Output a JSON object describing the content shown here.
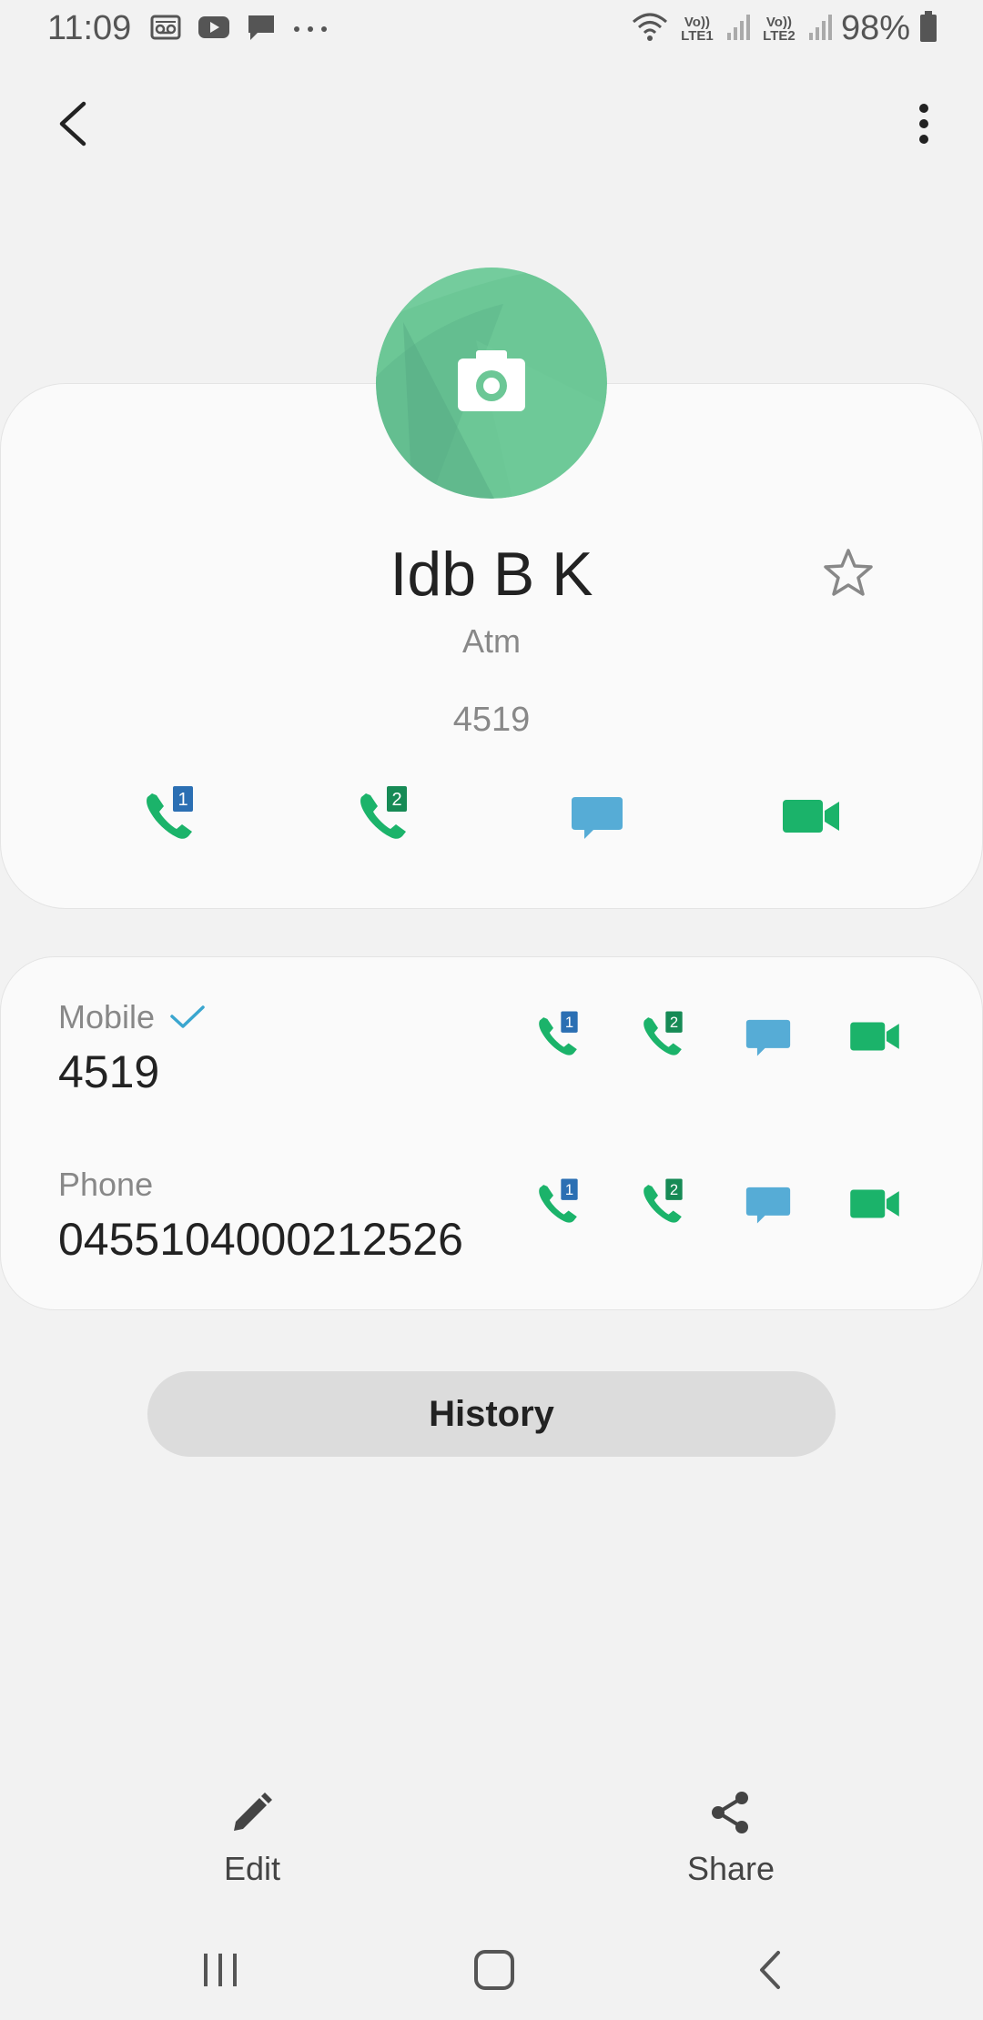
{
  "status_bar": {
    "time": "11:09",
    "sim1_label": "Vo)) LTE1",
    "sim2_label": "Vo)) LTE2",
    "battery": "98%"
  },
  "contact": {
    "name": "Idb B K",
    "company": "Atm",
    "number": "4519"
  },
  "numbers": [
    {
      "label": "Mobile",
      "value": "4519",
      "default": true
    },
    {
      "label": "Phone",
      "value": "04551040002125 26"
    }
  ],
  "history_label": "History",
  "bottom_actions": {
    "edit_label": "Edit",
    "share_label": "Share"
  },
  "colors": {
    "call_green": "#1bb36a",
    "sim1_badge": "#2b6fb3",
    "sim2_badge": "#168a55",
    "message_blue": "#56acd6",
    "avatar_green": "#66c695",
    "check_blue": "#3aa6cf"
  },
  "icons": {
    "call_sim1": "phone-sim1-icon",
    "call_sim2": "phone-sim2-icon",
    "message": "message-icon",
    "video": "video-call-icon",
    "camera": "camera-icon",
    "star": "star-icon",
    "edit": "pencil-icon",
    "share": "share-icon"
  }
}
